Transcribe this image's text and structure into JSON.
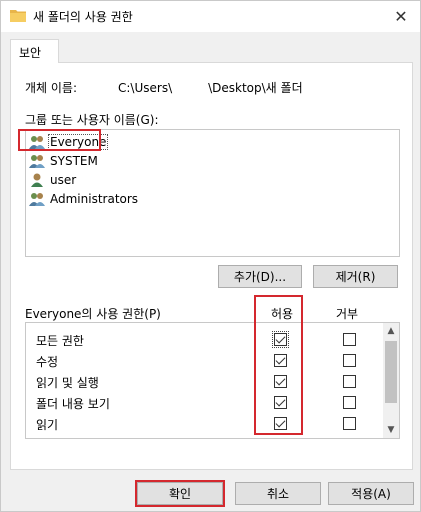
{
  "window": {
    "title": "새 폴더의 사용 권한",
    "close_symbol": "✕"
  },
  "tabs": [
    {
      "label": "보안"
    }
  ],
  "object": {
    "label": "개체 이름:",
    "path": "C:\\Users\\　　　\\Desktop\\새 폴더"
  },
  "groups": {
    "label": "그룹 또는 사용자 이름(G):",
    "items": [
      {
        "name": "Everyone",
        "icon": "group-icon",
        "selected": true
      },
      {
        "name": "SYSTEM",
        "icon": "group-icon",
        "selected": false
      },
      {
        "name": "user",
        "icon": "user-icon",
        "selected": false
      },
      {
        "name": "Administrators",
        "icon": "group-icon",
        "selected": false
      }
    ]
  },
  "buttons": {
    "add": "추가(D)...",
    "remove": "제거(R)",
    "ok": "확인",
    "cancel": "취소",
    "apply": "적용(A)"
  },
  "permissions": {
    "label": "Everyone의 사용 권한(P)",
    "allow_header": "허용",
    "deny_header": "거부",
    "rows": [
      {
        "name": "모든 권한",
        "allow": true,
        "deny": false
      },
      {
        "name": "수정",
        "allow": true,
        "deny": false
      },
      {
        "name": "읽기 및 실행",
        "allow": true,
        "deny": false
      },
      {
        "name": "폴더 내용 보기",
        "allow": true,
        "deny": false
      },
      {
        "name": "읽기",
        "allow": true,
        "deny": false
      }
    ]
  },
  "colors": {
    "highlight": "#d4282e",
    "folder": "#e8b54a"
  }
}
